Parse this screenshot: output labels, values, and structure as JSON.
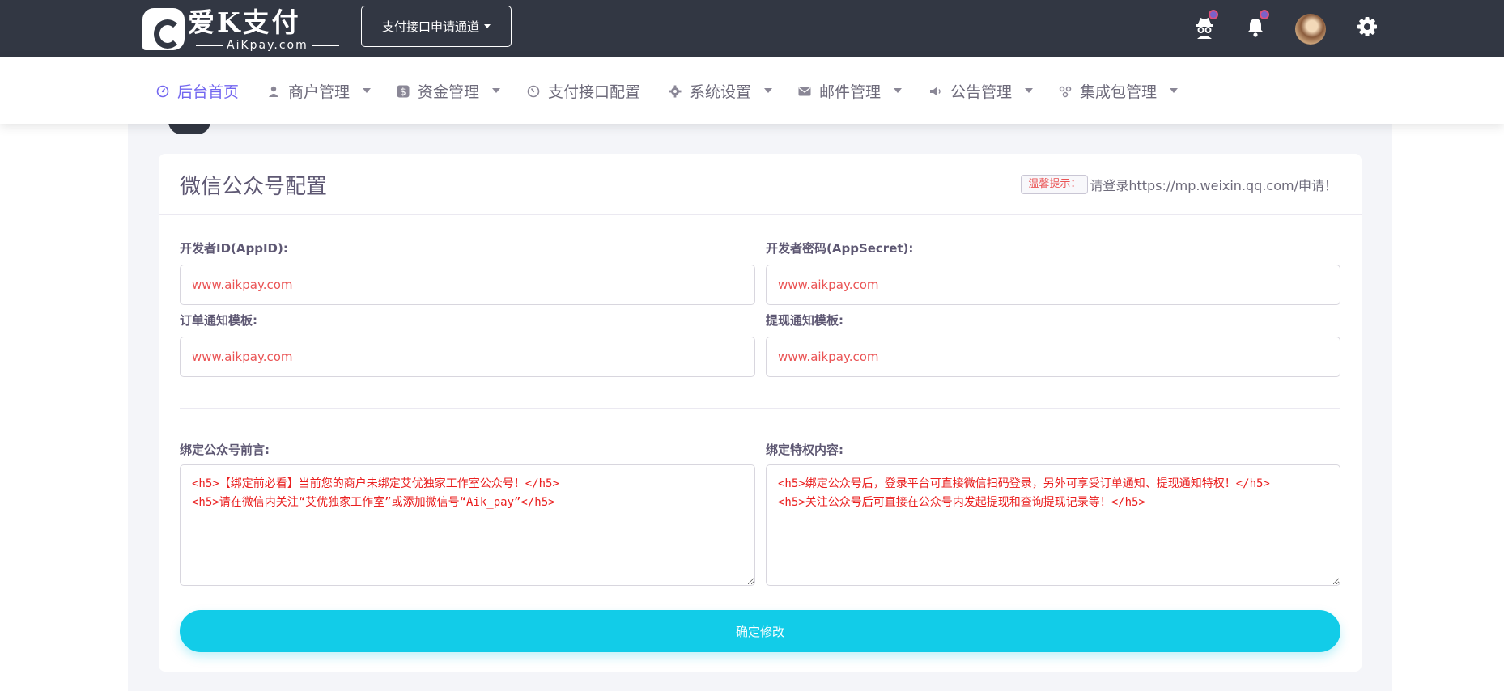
{
  "brand": {
    "name": "爱K支付",
    "sub": "AiKpay.com"
  },
  "topbar": {
    "channel_label": "支付接口申请通道"
  },
  "nav": [
    {
      "label": "后台首页",
      "icon": "dashboard-icon",
      "dropdown": false,
      "active": true
    },
    {
      "label": "商户管理",
      "icon": "user-icon",
      "dropdown": true,
      "active": false
    },
    {
      "label": "资金管理",
      "icon": "dollar-icon",
      "dropdown": true,
      "active": false
    },
    {
      "label": "支付接口配置",
      "icon": "gauge-icon",
      "dropdown": false,
      "active": false
    },
    {
      "label": "系统设置",
      "icon": "gear-icon",
      "dropdown": true,
      "active": false
    },
    {
      "label": "邮件管理",
      "icon": "mail-icon",
      "dropdown": true,
      "active": false
    },
    {
      "label": "公告管理",
      "icon": "megaphone-icon",
      "dropdown": true,
      "active": false
    },
    {
      "label": "集成包管理",
      "icon": "package-icon",
      "dropdown": true,
      "active": false
    }
  ],
  "card": {
    "title": "微信公众号配置",
    "hint_badge": "温馨提示：",
    "hint_text": "请登录https://mp.weixin.qq.com/申请！"
  },
  "form": {
    "appid_label": "开发者ID(AppID):",
    "appid_value": "www.aikpay.com",
    "secret_label": "开发者密码(AppSecret):",
    "secret_value": "www.aikpay.com",
    "order_tpl_label": "订单通知模板:",
    "order_tpl_value": "www.aikpay.com",
    "withdraw_tpl_label": "提现通知模板:",
    "withdraw_tpl_value": "www.aikpay.com",
    "bind_preface_label": "绑定公众号前言:",
    "bind_preface_value": "<h5>【绑定前必看】当前您的商户未绑定艾优独家工作室公众号！</h5>\n<h5>请在微信内关注“艾优独家工作室”或添加微信号“Aik_pay”</h5>",
    "bind_privilege_label": "绑定特权内容:",
    "bind_privilege_value": "<h5>绑定公众号后，登录平台可直接微信扫码登录，另外可享受订单通知、提现通知特权！</h5>\n<h5>关注公众号后可直接在公众号内发起提现和查询提现记录等！</h5>",
    "submit_label": "确定修改"
  },
  "colors": {
    "topbar": "#323743",
    "accent": "#7367f0",
    "submit": "#12cce8",
    "value_text": "#ea5455"
  }
}
